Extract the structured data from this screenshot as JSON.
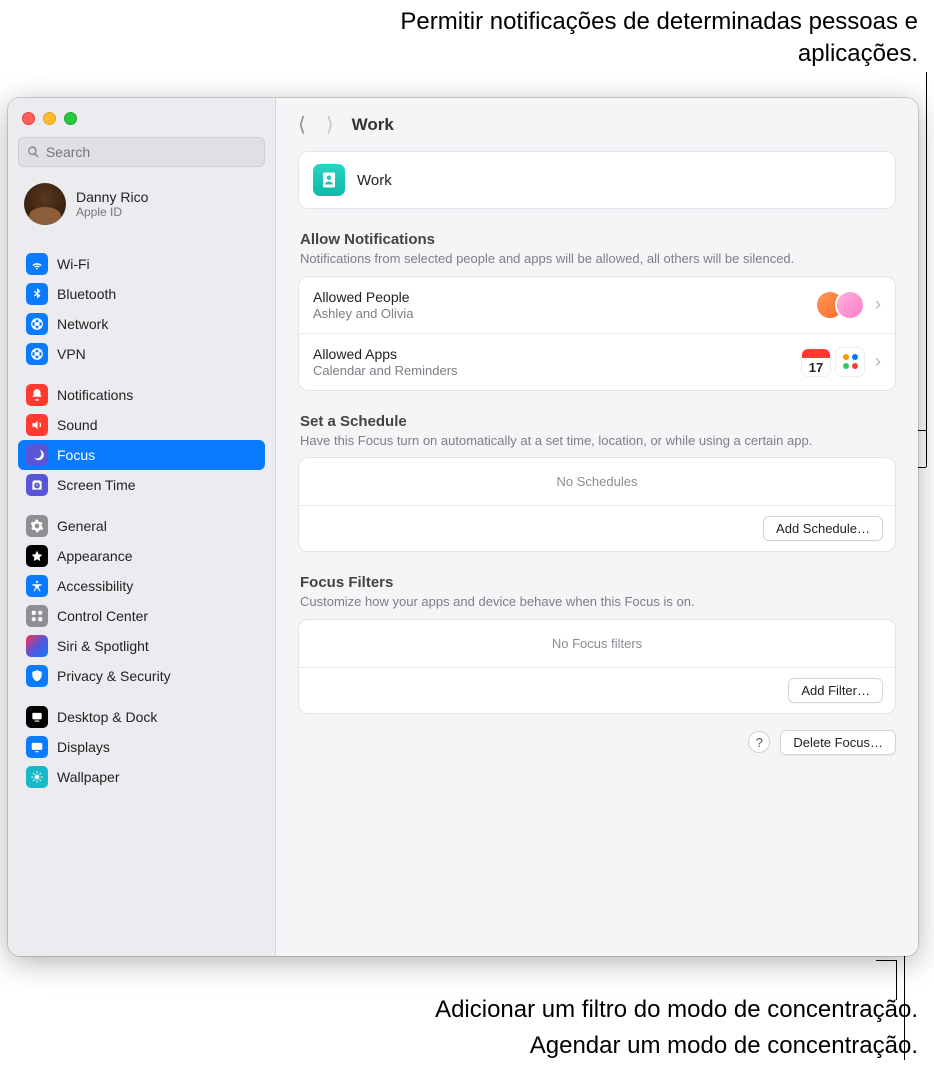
{
  "callouts": {
    "top": "Permitir notificações de determinadas pessoas e aplicações.",
    "bottom1": "Adicionar um filtro do modo de concentração.",
    "bottom2": "Agendar um modo de concentração."
  },
  "search": {
    "placeholder": "Search"
  },
  "profile": {
    "name": "Danny Rico",
    "sub": "Apple ID"
  },
  "sidebar": {
    "items": [
      {
        "label": "Wi-Fi",
        "color": "#0a7aff"
      },
      {
        "label": "Bluetooth",
        "color": "#0a7aff"
      },
      {
        "label": "Network",
        "color": "#0a7aff"
      },
      {
        "label": "VPN",
        "color": "#0a7aff"
      },
      {
        "label": "Notifications",
        "color": "#ff3b30"
      },
      {
        "label": "Sound",
        "color": "#ff3b30"
      },
      {
        "label": "Focus",
        "color": "#5856d6",
        "selected": true
      },
      {
        "label": "Screen Time",
        "color": "#5856d6"
      },
      {
        "label": "General",
        "color": "#8e8e93"
      },
      {
        "label": "Appearance",
        "color": "#000000"
      },
      {
        "label": "Accessibility",
        "color": "#0a7aff"
      },
      {
        "label": "Control Center",
        "color": "#8e8e93"
      },
      {
        "label": "Siri & Spotlight",
        "color": "#000000"
      },
      {
        "label": "Privacy & Security",
        "color": "#0a7aff"
      },
      {
        "label": "Desktop & Dock",
        "color": "#000000"
      },
      {
        "label": "Displays",
        "color": "#0a7aff"
      },
      {
        "label": "Wallpaper",
        "color": "#17b8c8"
      }
    ]
  },
  "toolbar": {
    "title": "Work"
  },
  "header": {
    "name": "Work"
  },
  "allow": {
    "title": "Allow Notifications",
    "desc": "Notifications from selected people and apps will be allowed, all others will be silenced.",
    "people": {
      "title": "Allowed People",
      "sub": "Ashley and Olivia"
    },
    "apps": {
      "title": "Allowed Apps",
      "sub": "Calendar and Reminders",
      "calDay": "17"
    }
  },
  "schedule": {
    "title": "Set a Schedule",
    "desc": "Have this Focus turn on automatically at a set time, location, or while using a certain app.",
    "empty": "No Schedules",
    "button": "Add Schedule…"
  },
  "filters": {
    "title": "Focus Filters",
    "desc": "Customize how your apps and device behave when this Focus is on.",
    "empty": "No Focus filters",
    "button": "Add Filter…"
  },
  "footer": {
    "help": "?",
    "delete": "Delete Focus…"
  }
}
